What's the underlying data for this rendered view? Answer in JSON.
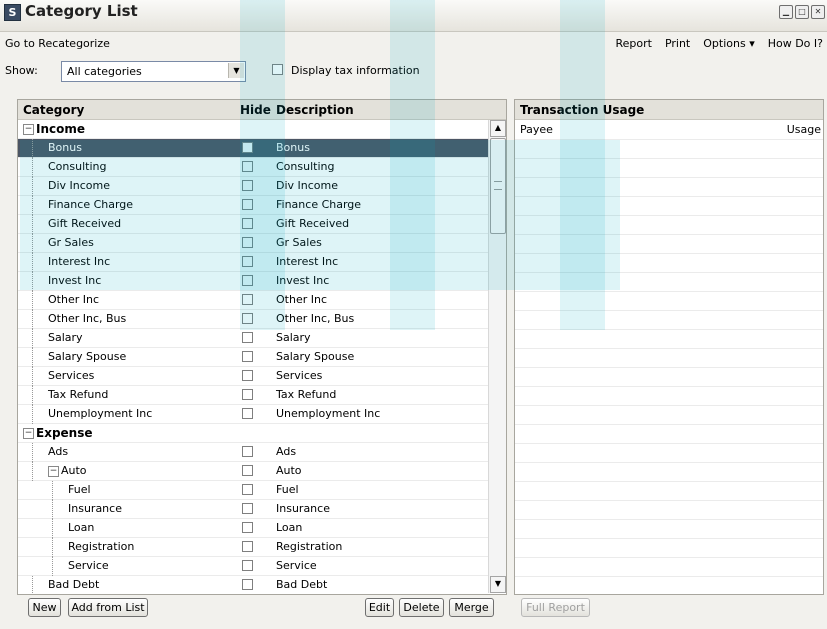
{
  "window": {
    "title": "Category List",
    "icon_letter": "S"
  },
  "menu": {
    "left": "Go to Recategorize",
    "right": [
      "Report",
      "Print",
      "Options ▾",
      "How Do I?"
    ]
  },
  "filter": {
    "show_label": "Show:",
    "selected": "All categories",
    "tax_label": "Display tax information"
  },
  "columns": {
    "category": "Category",
    "hide": "Hide",
    "description": "Description"
  },
  "rows": [
    {
      "name": "Income",
      "desc": "",
      "group": true,
      "level": 0
    },
    {
      "name": "Bonus",
      "desc": "Bonus",
      "level": 1,
      "selected": true
    },
    {
      "name": "Consulting",
      "desc": "Consulting",
      "level": 1
    },
    {
      "name": "Div Income",
      "desc": "Div Income",
      "level": 1
    },
    {
      "name": "Finance Charge",
      "desc": "Finance Charge",
      "level": 1
    },
    {
      "name": "Gift Received",
      "desc": "Gift Received",
      "level": 1
    },
    {
      "name": "Gr Sales",
      "desc": "Gr Sales",
      "level": 1
    },
    {
      "name": "Interest Inc",
      "desc": "Interest Inc",
      "level": 1
    },
    {
      "name": "Invest Inc",
      "desc": "Invest Inc",
      "level": 1
    },
    {
      "name": "Other Inc",
      "desc": "Other Inc",
      "level": 1
    },
    {
      "name": "Other Inc, Bus",
      "desc": "Other Inc, Bus",
      "level": 1
    },
    {
      "name": "Salary",
      "desc": "Salary",
      "level": 1
    },
    {
      "name": "Salary Spouse",
      "desc": "Salary Spouse",
      "level": 1
    },
    {
      "name": "Services",
      "desc": "Services",
      "level": 1
    },
    {
      "name": "Tax Refund",
      "desc": "Tax Refund",
      "level": 1
    },
    {
      "name": "Unemployment Inc",
      "desc": "Unemployment Inc",
      "level": 1
    },
    {
      "name": "Expense",
      "desc": "",
      "group": true,
      "level": 0
    },
    {
      "name": "Ads",
      "desc": "Ads",
      "level": 1
    },
    {
      "name": "Auto",
      "desc": "Auto",
      "level": 1,
      "expandable": true
    },
    {
      "name": "Fuel",
      "desc": "Fuel",
      "level": 2
    },
    {
      "name": "Insurance",
      "desc": "Insurance",
      "level": 2
    },
    {
      "name": "Loan",
      "desc": "Loan",
      "level": 2
    },
    {
      "name": "Registration",
      "desc": "Registration",
      "level": 2
    },
    {
      "name": "Service",
      "desc": "Service",
      "level": 2
    },
    {
      "name": "Bad Debt",
      "desc": "Bad Debt",
      "level": 1
    }
  ],
  "usage": {
    "title": "Transaction Usage",
    "payee": "Payee",
    "usage": "Usage"
  },
  "buttons": {
    "new": "New",
    "add_from_list": "Add from List",
    "edit": "Edit",
    "delete": "Delete",
    "merge": "Merge",
    "full_report": "Full Report"
  },
  "colors": {
    "selected_row": "#4b5564",
    "watermark": "#00aabe"
  }
}
